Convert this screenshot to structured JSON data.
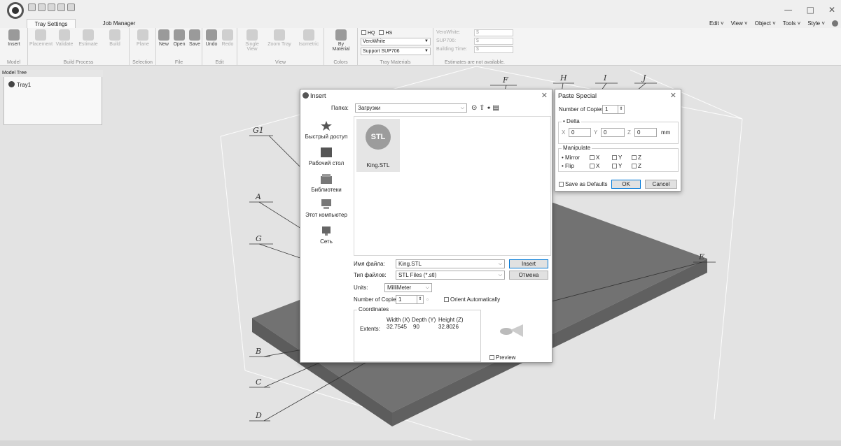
{
  "title_bar": {
    "window_controls": [
      "—",
      "□",
      "✕"
    ]
  },
  "ribbon_tabs": [
    "Tray Settings",
    "Job Manager"
  ],
  "top_menu": [
    "Edit ˅",
    "View ˅",
    "Object ˅",
    "Tools ˅",
    "Style ˅"
  ],
  "ribbon": {
    "groups": [
      {
        "label": "Model",
        "buttons": [
          "Insert"
        ]
      },
      {
        "label": "Build Process",
        "buttons": [
          "Placement",
          "Validate",
          "Estimate",
          "Build"
        ]
      },
      {
        "label": "Selection",
        "buttons": [
          "Plane"
        ]
      },
      {
        "label": "File",
        "buttons": [
          "New",
          "Open",
          "Save"
        ]
      },
      {
        "label": "Edit",
        "buttons": [
          "Undo",
          "Redo"
        ]
      },
      {
        "label": "View",
        "buttons": [
          "Single View",
          "Zoom Tray",
          "Isometric"
        ]
      },
      {
        "label": "Colors",
        "buttons": [
          "By Material"
        ]
      }
    ],
    "materials": {
      "label": "Tray Materials",
      "hq": "HQ",
      "hs": "HS",
      "model_material": "VeroWhite",
      "support_material": "Support SUP706"
    },
    "estimates": {
      "label": "Estimates are not available.",
      "rows": [
        {
          "label": "VeroWhite:",
          "value": "$"
        },
        {
          "label": "SUP706:",
          "value": "$"
        },
        {
          "label": "Building Time:",
          "value": "$"
        }
      ]
    }
  },
  "model_tree": {
    "header": "Model Tree",
    "items": [
      "Tray1"
    ]
  },
  "insert_dialog": {
    "title": "Insert",
    "folder_label": "Папка:",
    "folder_value": "Загрузки",
    "places": [
      "Быстрый доступ",
      "Рабочий стол",
      "Библиотеки",
      "Этот компьютер",
      "Сеть"
    ],
    "file": {
      "name": "King.STL",
      "icon_text": "STL"
    },
    "filename_label": "Имя файла:",
    "filename_value": "King.STL",
    "filetype_label": "Тип файлов:",
    "filetype_value": "STL Files (*.stl)",
    "insert_button": "Insert",
    "cancel_button": "Отмена",
    "units_label": "Units:",
    "units_value": "MilliMeter",
    "copies_label": "Number of Copies :",
    "copies_value": "1",
    "orient_label": "Orient Automatically",
    "coordinates": {
      "legend": "Coordinates",
      "width_label": "Width (X)",
      "depth_label": "Depth (Y)",
      "height_label": "Height (Z)",
      "extents_label": "Extents:",
      "width": "32.7545",
      "depth": "90",
      "height": "32.8026"
    },
    "preview_label": "Preview"
  },
  "paste_special": {
    "title": "Paste Special",
    "copies_label": "Number of Copies",
    "copies_value": "1",
    "delta_label": "Delta",
    "x_label": "X",
    "x_value": "0",
    "y_label": "Y",
    "y_value": "0",
    "z_label": "Z",
    "z_value": "0",
    "unit": "mm",
    "manipulate_label": "Manipulate",
    "mirror_label": "Mirror",
    "flip_label": "Flip",
    "axis_x": "X",
    "axis_y": "Y",
    "axis_z": "Z",
    "save_defaults_label": "Save as Defaults",
    "ok_button": "OK",
    "cancel_button": "Cancel"
  },
  "callouts": [
    "F",
    "H",
    "I",
    "J",
    "G1",
    "A",
    "G",
    "E",
    "B",
    "C",
    "D"
  ],
  "colors": {
    "tray": "#707070",
    "accent": "#0078d7"
  }
}
